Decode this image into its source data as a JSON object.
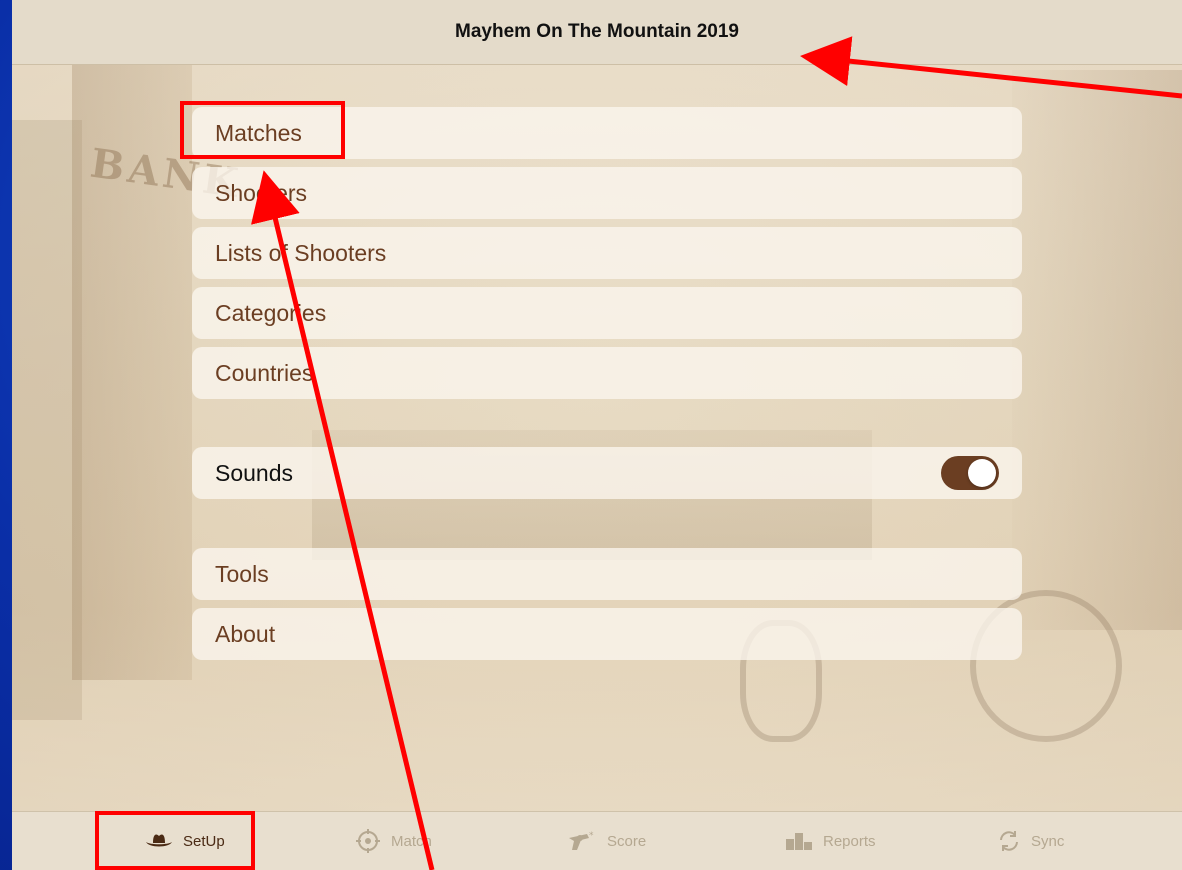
{
  "header": {
    "title": "Mayhem On The Mountain 2019"
  },
  "menu": {
    "group1": [
      {
        "label": "Matches"
      },
      {
        "label": "Shooters"
      },
      {
        "label": "Lists of Shooters"
      },
      {
        "label": "Categories"
      },
      {
        "label": "Countries"
      }
    ],
    "sounds": {
      "label": "Sounds",
      "enabled": true
    },
    "group3": [
      {
        "label": "Tools"
      },
      {
        "label": "About"
      }
    ]
  },
  "tabbar": {
    "tabs": [
      {
        "label": "SetUp",
        "icon": "cowboy-hat-icon",
        "active": true
      },
      {
        "label": "Match",
        "icon": "crosshair-icon",
        "active": false
      },
      {
        "label": "Score",
        "icon": "revolver-icon",
        "active": false
      },
      {
        "label": "Reports",
        "icon": "podium-icon",
        "active": false
      },
      {
        "label": "Sync",
        "icon": "sync-icon",
        "active": false
      }
    ]
  },
  "colors": {
    "accent": "#6b3e22",
    "annotation": "#ff0000",
    "slide_background": "#0a2fa8"
  }
}
